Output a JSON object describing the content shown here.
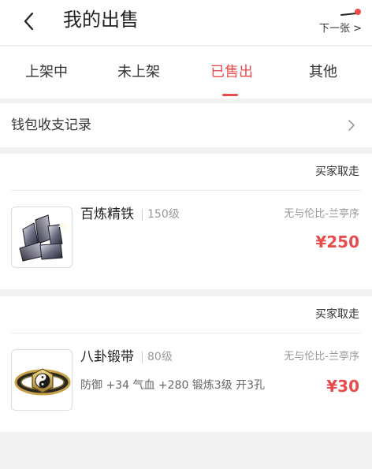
{
  "header": {
    "title": "我的出售",
    "next_label": "下一张 >"
  },
  "tabs": [
    {
      "label": "上架中",
      "active": false
    },
    {
      "label": "未上架",
      "active": false
    },
    {
      "label": "已售出",
      "active": true
    },
    {
      "label": "其他",
      "active": false
    }
  ],
  "wallet": {
    "label": "钱包收支记录"
  },
  "orders": [
    {
      "status": "买家取走",
      "name": "百炼精铁",
      "level": "150级",
      "seller": "无与伦比-兰亭序",
      "attributes": "",
      "price": "¥250"
    },
    {
      "status": "买家取走",
      "name": "八卦锻带",
      "level": "80级",
      "seller": "无与伦比-兰亭序",
      "attributes": "防御 +34 气血 +280 锻炼3级 开3孔",
      "price": "¥30"
    }
  ],
  "colors": {
    "accent": "#e84c4c",
    "notification_dot": "#e84c4c"
  }
}
